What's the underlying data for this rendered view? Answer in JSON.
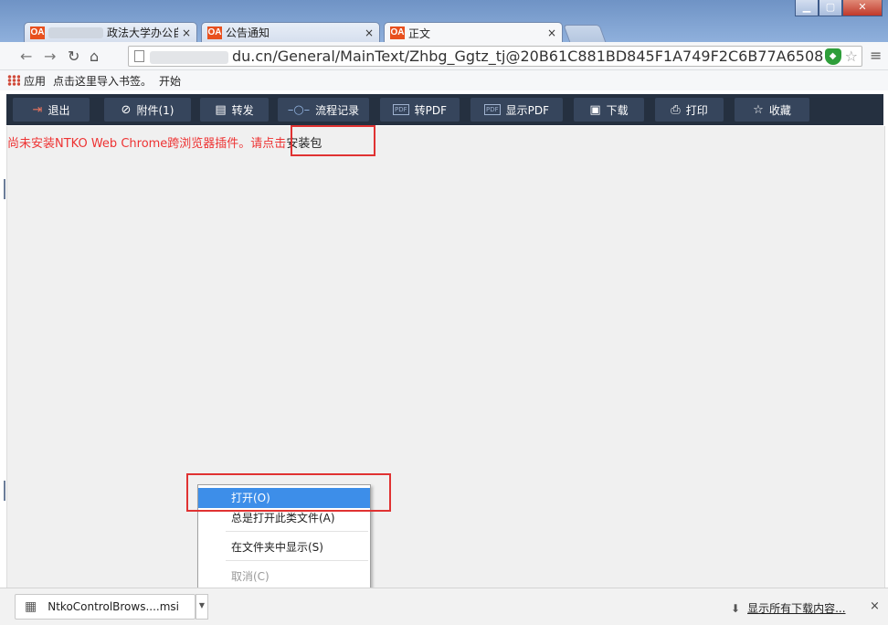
{
  "browser": {
    "tabs": [
      {
        "label": "政法大学办公自",
        "close": "×"
      },
      {
        "label": "公告通知",
        "close": "×"
      },
      {
        "label": "正文",
        "close": "×",
        "active": true
      }
    ],
    "favicon_text": "OA",
    "url_domain_tail": "du.cn",
    "url_path": "/General/MainText/Zhbg_Ggtz_tj@20B61C881BD845F1A749F2C6B77A6508",
    "bookmarks": {
      "apps": "应用",
      "import": "点击这里导入书签。",
      "start": "开始"
    }
  },
  "toolbar": {
    "buttons": [
      {
        "label": "退出",
        "icon": "exit-icon"
      },
      {
        "label": "附件(1)",
        "icon": "paperclip-icon"
      },
      {
        "label": "转发",
        "icon": "forward-icon"
      },
      {
        "label": "流程记录",
        "icon": "flow-icon"
      },
      {
        "label": "转PDF",
        "icon": "pdf-icon"
      },
      {
        "label": "显示PDF",
        "icon": "pdf-icon"
      },
      {
        "label": "下载",
        "icon": "save-icon"
      },
      {
        "label": "打印",
        "icon": "printer-icon"
      },
      {
        "label": "收藏",
        "icon": "star-icon"
      }
    ]
  },
  "notice": {
    "text": "尚未安装NTKO Web Chrome跨浏览器插件。请点击",
    "link": "安装包"
  },
  "context_menu": {
    "items": [
      {
        "label": "打开(O)",
        "selected": true
      },
      {
        "label": "总是打开此类文件(A)"
      },
      {
        "label": "在文件夹中显示(S)"
      },
      {
        "label": "取消(C)",
        "disabled": true
      }
    ]
  },
  "download_bar": {
    "file_name": "NtkoControlBrows....msi",
    "show_all": "显示所有下载内容...",
    "close": "×"
  },
  "colors": {
    "oa_toolbar": "#253040",
    "oa_button": "#36455c",
    "notice_red": "#e33333",
    "highlight_red": "#e03232",
    "menu_selected": "#3d8ee9"
  }
}
